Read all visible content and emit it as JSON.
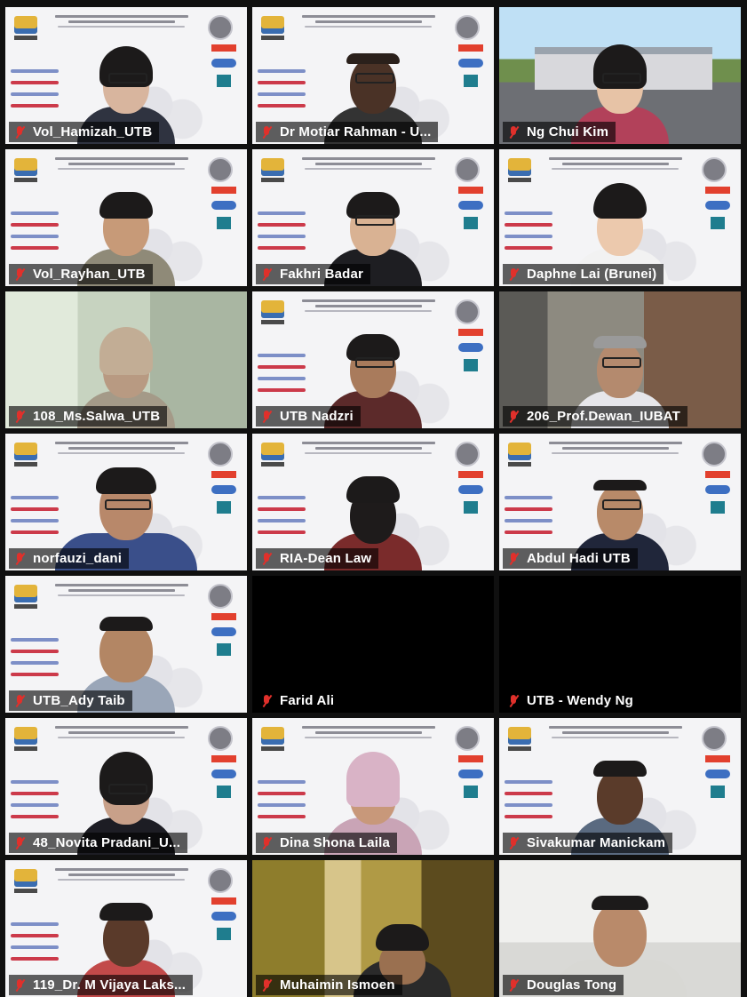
{
  "tiles": [
    {
      "name": "Vol_Hamizah_UTB",
      "kind": "slide"
    },
    {
      "name": "Dr Motiar Rahman - U...",
      "kind": "slide"
    },
    {
      "name": "Ng Chui Kim",
      "kind": "gate"
    },
    {
      "name": "Vol_Rayhan_UTB",
      "kind": "slide"
    },
    {
      "name": "Fakhri Badar",
      "kind": "slide"
    },
    {
      "name": "Daphne Lai (Brunei)",
      "kind": "slide"
    },
    {
      "name": "108_Ms.Salwa_UTB",
      "kind": "wall"
    },
    {
      "name": "UTB Nadzri",
      "kind": "slide"
    },
    {
      "name": "206_Prof.Dewan_IUBAT",
      "kind": "office"
    },
    {
      "name": "norfauzi_dani",
      "kind": "slide"
    },
    {
      "name": "RIA-Dean Law",
      "kind": "slide"
    },
    {
      "name": "Abdul Hadi UTB",
      "kind": "slide"
    },
    {
      "name": "UTB_Ady Taib",
      "kind": "slide"
    },
    {
      "name": "Farid Ali",
      "kind": "off"
    },
    {
      "name": "UTB - Wendy Ng",
      "kind": "off"
    },
    {
      "name": "48_Novita Pradani_U...",
      "kind": "slide"
    },
    {
      "name": "Dina Shona Laila",
      "kind": "slide"
    },
    {
      "name": "Sivakumar Manickam",
      "kind": "slide"
    },
    {
      "name": "119_Dr. M Vijaya Laks...",
      "kind": "slide"
    },
    {
      "name": "Muhaimin Ismoen",
      "kind": "hotel"
    },
    {
      "name": "Douglas Tong",
      "kind": "room"
    }
  ],
  "icons": {
    "muted": "mic-muted-icon"
  },
  "colors": {
    "muted_red": "#e0302b",
    "label_bg": "#000000",
    "grid_bg": "#101010"
  }
}
